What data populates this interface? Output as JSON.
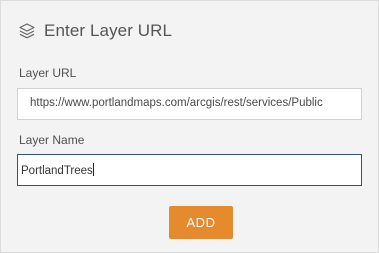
{
  "header": {
    "icon": "layers-icon",
    "title": "Enter Layer URL"
  },
  "layer_url": {
    "label": "Layer URL",
    "value": "https://www.portlandmaps.com/arcgis/rest/services/Public"
  },
  "layer_name": {
    "label": "Layer Name",
    "value": "PortlandTrees"
  },
  "add_button": {
    "label": "ADD",
    "color": "#e68a2e"
  },
  "colors": {
    "background": "#f3f3f3",
    "focus_border": "#31527d"
  }
}
